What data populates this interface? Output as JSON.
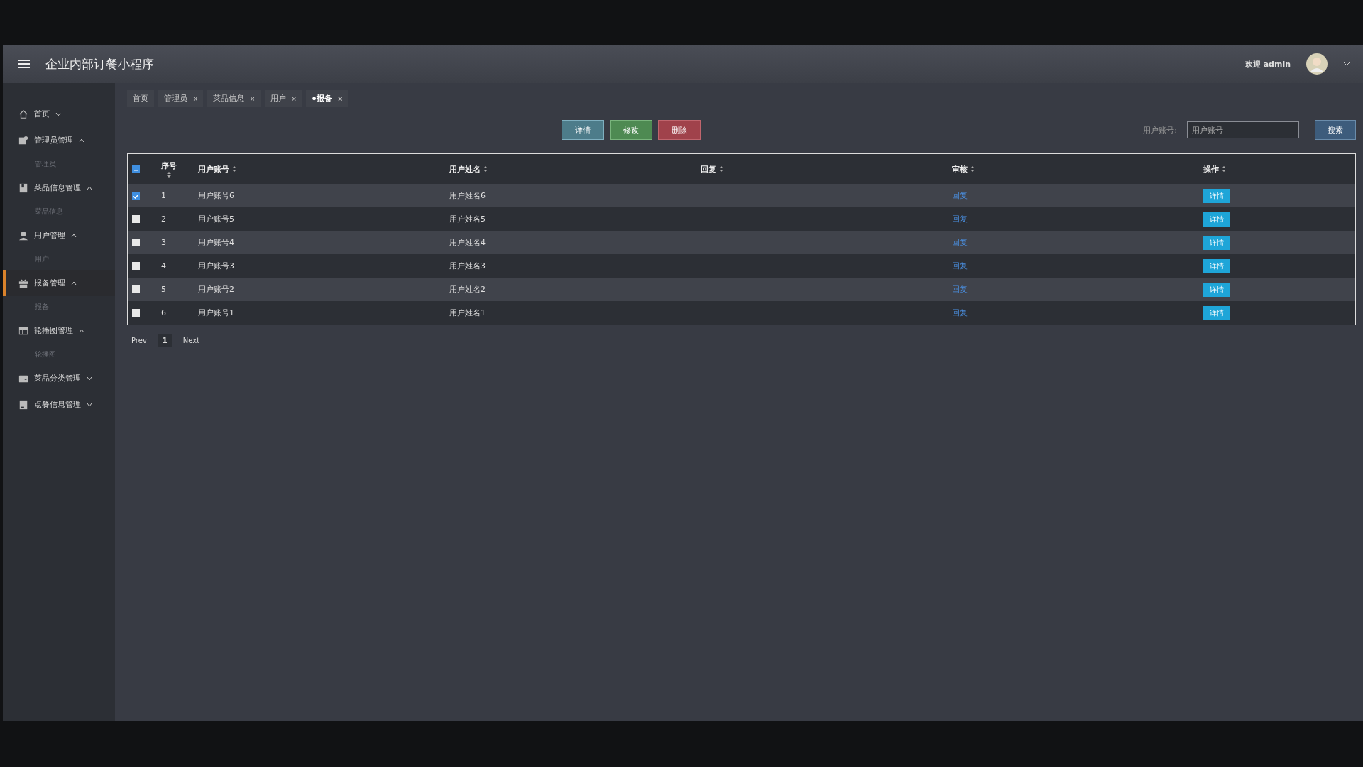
{
  "header": {
    "title": "企业内部订餐小程序",
    "welcome": "欢迎 admin"
  },
  "sidebar": {
    "items": [
      {
        "label": "首页",
        "expanded": false,
        "selected": false
      },
      {
        "label": "管理员管理",
        "expanded": true,
        "selected": false,
        "children": [
          {
            "label": "管理员"
          }
        ]
      },
      {
        "label": "菜品信息管理",
        "expanded": true,
        "selected": false,
        "children": [
          {
            "label": "菜品信息"
          }
        ]
      },
      {
        "label": "用户管理",
        "expanded": true,
        "selected": false,
        "children": [
          {
            "label": "用户"
          }
        ]
      },
      {
        "label": "报备管理",
        "expanded": true,
        "selected": true,
        "children": [
          {
            "label": "报备"
          }
        ]
      },
      {
        "label": "轮播图管理",
        "expanded": true,
        "selected": false,
        "children": [
          {
            "label": "轮播图"
          }
        ]
      },
      {
        "label": "菜品分类管理",
        "expanded": false,
        "selected": false
      },
      {
        "label": "点餐信息管理",
        "expanded": false,
        "selected": false
      }
    ]
  },
  "tabs": [
    {
      "label": "首页",
      "selected": false
    },
    {
      "label": "管理员",
      "close": "×",
      "selected": false
    },
    {
      "label": "菜品信息",
      "close": "×",
      "selected": false
    },
    {
      "label": "用户",
      "close": "×",
      "selected": false
    },
    {
      "label": "●报备",
      "close": "×",
      "selected": true
    }
  ],
  "toolbar": {
    "buttons": [
      {
        "label": "详情",
        "kind": "info"
      },
      {
        "label": "修改",
        "kind": "edit"
      },
      {
        "label": "删除",
        "kind": "delete"
      }
    ],
    "search_label": "用户账号:",
    "search_placeholder": "用户账号",
    "search_button": "搜索"
  },
  "table": {
    "header_checkbox": {
      "indeterminate": true
    },
    "columns": [
      "序号",
      "用户账号",
      "用户姓名",
      "回复",
      "审核",
      "操作"
    ],
    "rows": [
      {
        "checked": true,
        "index": "1",
        "account": "用户账号6",
        "name": "用户姓名6",
        "review": "回复",
        "action": "详情"
      },
      {
        "checked": false,
        "index": "2",
        "account": "用户账号5",
        "name": "用户姓名5",
        "review": "回复",
        "action": "详情"
      },
      {
        "checked": false,
        "index": "3",
        "account": "用户账号4",
        "name": "用户姓名4",
        "review": "回复",
        "action": "详情"
      },
      {
        "checked": false,
        "index": "4",
        "account": "用户账号3",
        "name": "用户姓名3",
        "review": "回复",
        "action": "详情"
      },
      {
        "checked": false,
        "index": "5",
        "account": "用户账号2",
        "name": "用户姓名2",
        "review": "回复",
        "action": "详情"
      },
      {
        "checked": false,
        "index": "6",
        "account": "用户账号1",
        "name": "用户姓名1",
        "review": "回复",
        "action": "详情"
      }
    ]
  },
  "pagination": {
    "prev": "Prev",
    "pages": [
      {
        "label": "1",
        "selected": true
      }
    ],
    "next": "Next"
  }
}
